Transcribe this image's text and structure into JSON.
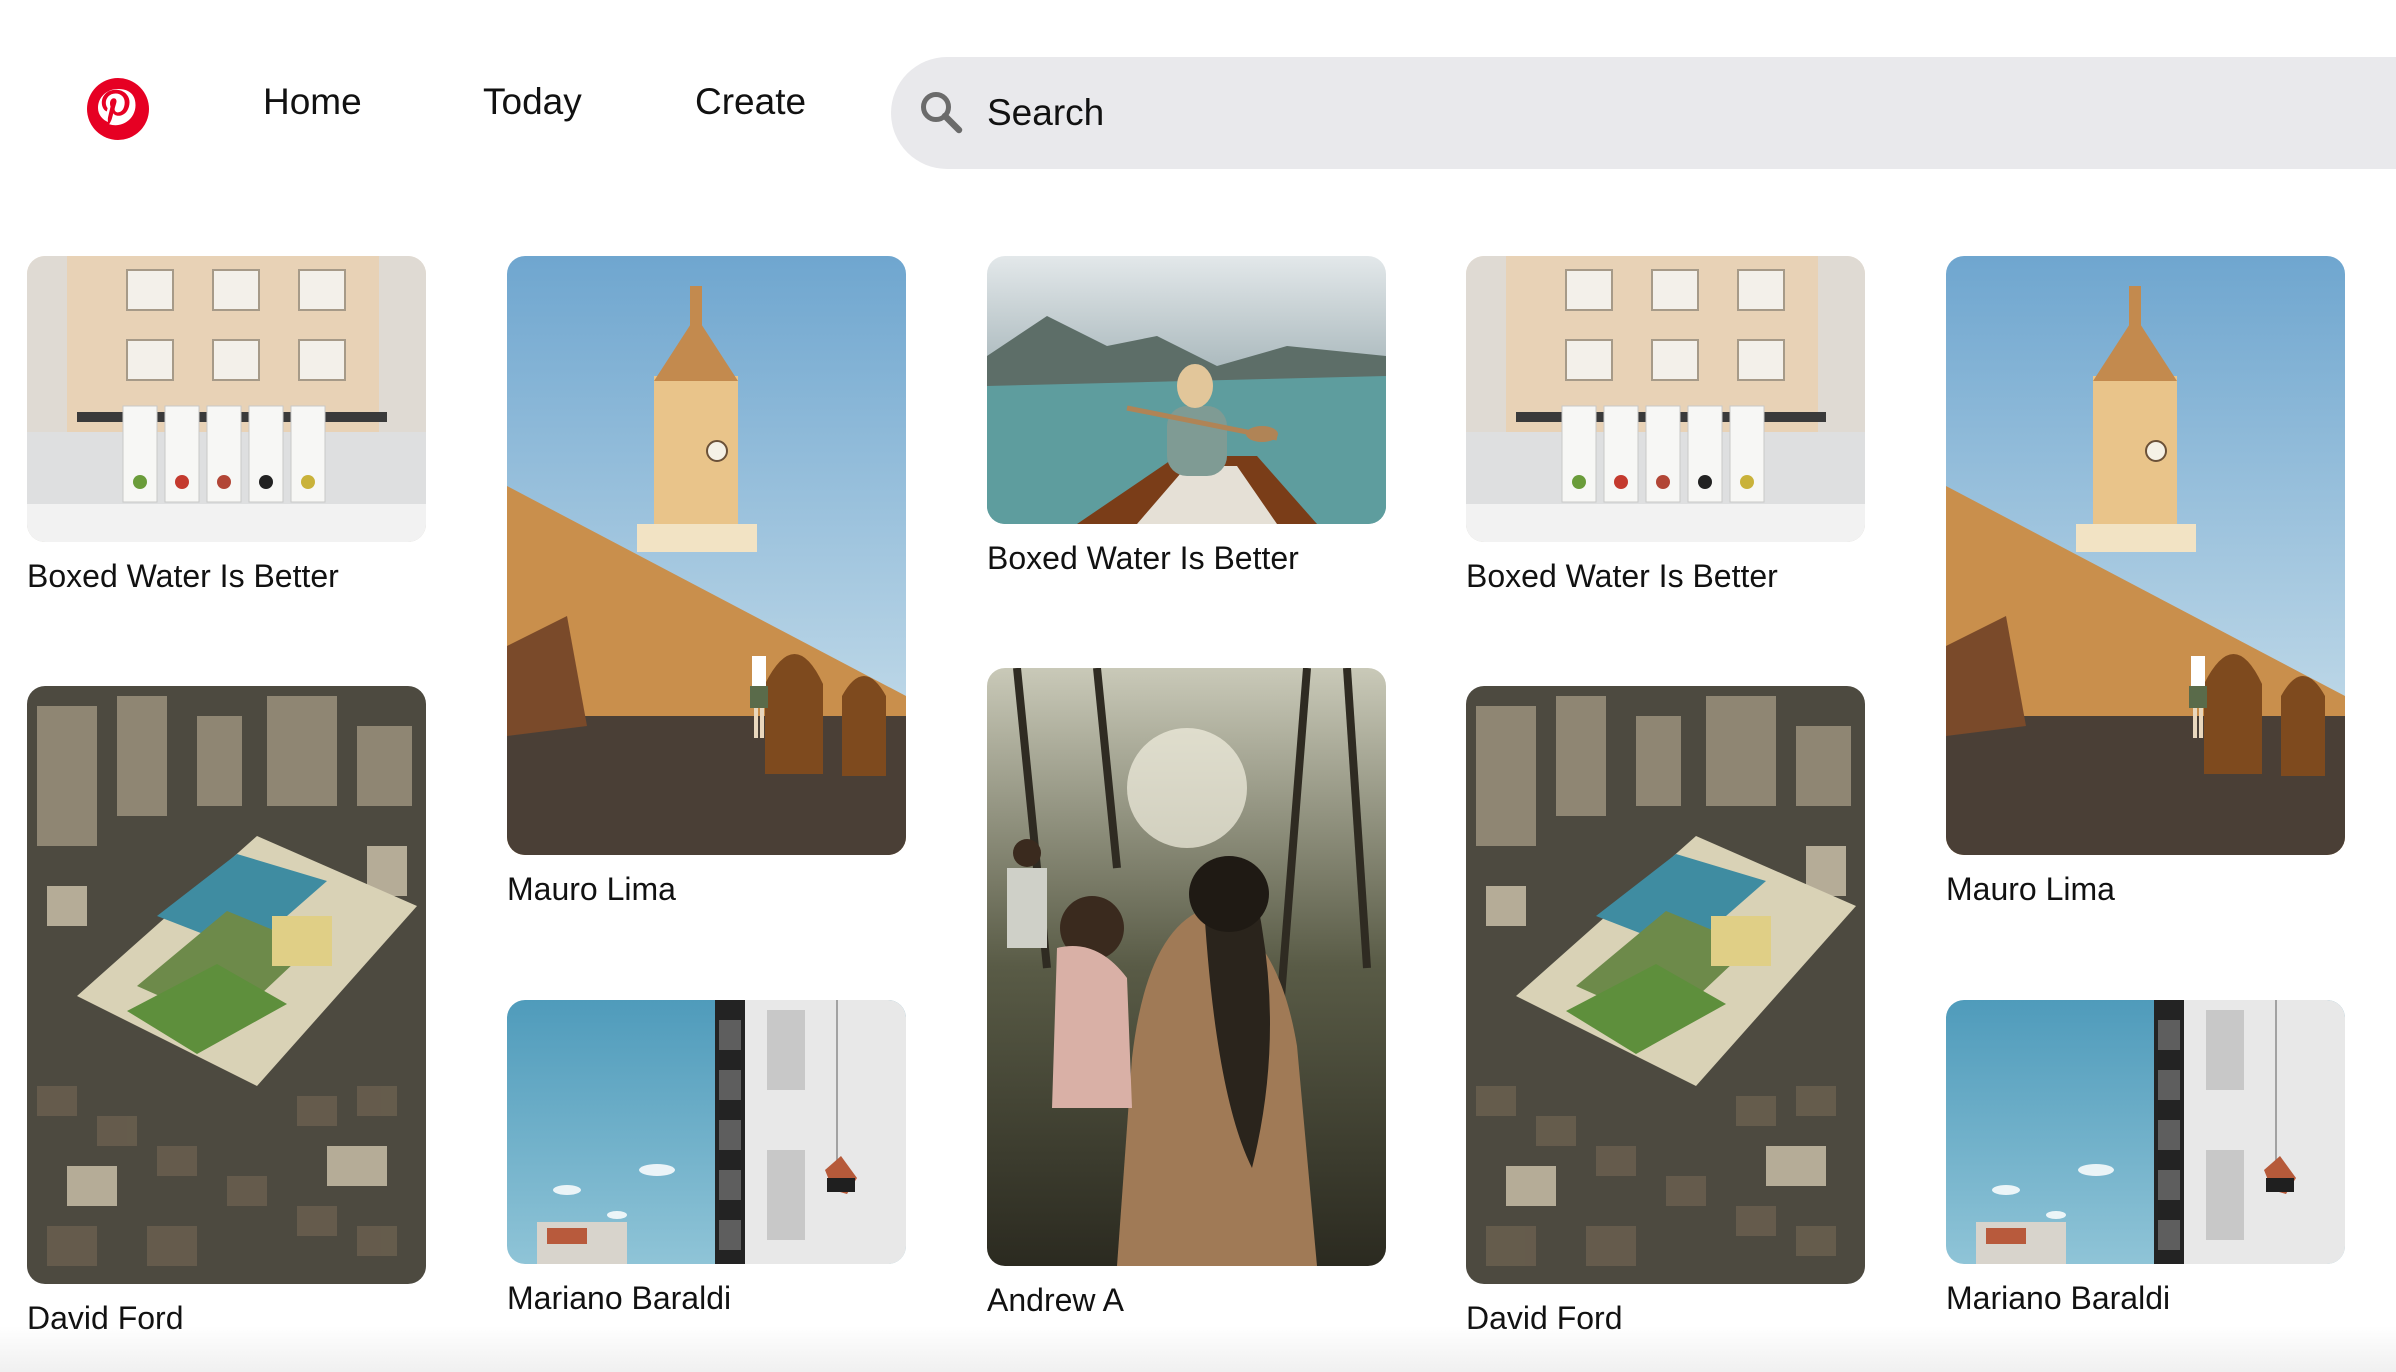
{
  "nav": {
    "home": "Home",
    "today": "Today",
    "create": "Create"
  },
  "logo": {
    "icon": "pinterest-logo",
    "color": "#e60023"
  },
  "search": {
    "placeholder": "Search",
    "icon": "search-icon"
  },
  "pins": [
    {
      "title": "Boxed Water Is Better",
      "image": "boxed-water-cartons"
    },
    {
      "title": "David Ford",
      "image": "aerial-city"
    },
    {
      "title": "Mauro Lima",
      "image": "clock-tower"
    },
    {
      "title": "Mariano Baraldi",
      "image": "window-cleaner"
    },
    {
      "title": "Boxed Water Is Better",
      "image": "canoe-lake"
    },
    {
      "title": "Andrew A",
      "image": "forest-people"
    },
    {
      "title": "Boxed Water Is Better",
      "image": "boxed-water-cartons"
    },
    {
      "title": "David Ford",
      "image": "aerial-city"
    },
    {
      "title": "Mauro Lima",
      "image": "clock-tower"
    },
    {
      "title": "Mariano Baraldi",
      "image": "window-cleaner"
    }
  ]
}
